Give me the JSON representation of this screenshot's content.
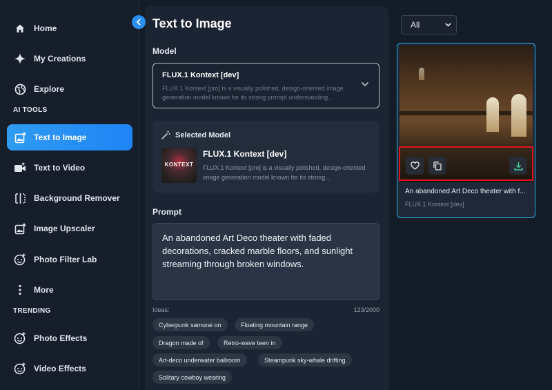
{
  "sidebar": {
    "items_top": [
      {
        "label": "Home",
        "icon": "home-icon"
      },
      {
        "label": "My Creations",
        "icon": "sparkle-icon"
      },
      {
        "label": "Explore",
        "icon": "globe-icon"
      }
    ],
    "section_ai_tools": "AI TOOLS",
    "ai_tools": [
      {
        "label": "Text to Image",
        "icon": "image-plus-icon",
        "active": true
      },
      {
        "label": "Text to Video",
        "icon": "video-plus-icon"
      },
      {
        "label": "Background Remover",
        "icon": "background-remover-icon"
      },
      {
        "label": "Image Upscaler",
        "icon": "upscale-icon"
      },
      {
        "label": "Photo Filter Lab",
        "icon": "filter-face-icon"
      },
      {
        "label": "More",
        "icon": "more-vertical-icon"
      }
    ],
    "section_trending": "TRENDING",
    "trending": [
      {
        "label": "Photo Effects",
        "icon": "photo-effects-icon"
      },
      {
        "label": "Video Effects",
        "icon": "video-effects-icon"
      }
    ]
  },
  "main": {
    "title": "Text to Image",
    "model_label": "Model",
    "model_select": {
      "name": "FLUX.1 Kontext [dev]",
      "description": "FLUX.1 Kontext [pro] is a visually polished, design-oriented image generation model known for its strong prompt understanding..."
    },
    "selected_model": {
      "heading": "Selected Model",
      "thumb_text": "KONTEXT",
      "name": "FLUX.1 Kontext [dev]",
      "description": "FLUX.1 Kontext [pro] is a visually polished, design-oriented image generation model known for its strong..."
    },
    "prompt_label": "Prompt",
    "prompt_text": "An abandoned Art Deco theater with faded decorations, cracked marble floors, and sunlight streaming through broken windows.",
    "ideas_label": "Ideas:",
    "counter": "123/2000",
    "ideas": [
      "Cyberpunk samurai on",
      "Floating mountain range",
      "Dragon made of",
      "Retro-wave teen in",
      "Art-deco underwater ballroom",
      "Steampunk sky-whale drifting",
      "Solitary cowboy wearing"
    ]
  },
  "results": {
    "filter_value": "All",
    "card": {
      "title": "An abandoned Art Deco theater with f...",
      "model": "FLUX.1 Kontext [dev]"
    }
  },
  "colors": {
    "accent": "#2b8ff0",
    "card_border": "#2fb3e6",
    "highlight": "#e0141e"
  }
}
